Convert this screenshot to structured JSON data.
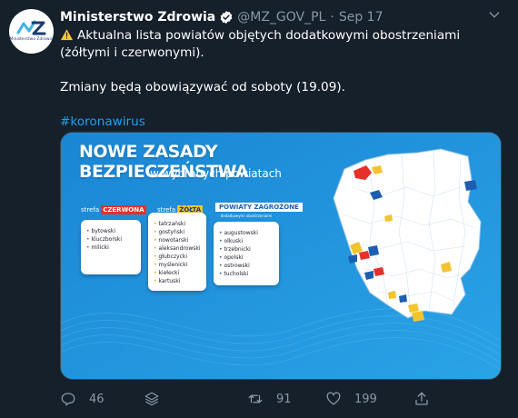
{
  "tweet": {
    "author_name": "Ministerstwo Zdrowia",
    "handle": "@MZ_GOV_PL",
    "separator": "·",
    "date": "Sep 17",
    "avatar_logo_text": "Ministerstwo Zdrowia",
    "text_line1": "Aktualna lista powiatów objętych dodatkowymi obostrzeniami (żółtymi i czerwonymi).",
    "text_line2": "Zmiany będą obowiązywać od soboty (19.09).",
    "hashtag": "#koronawirus"
  },
  "infographic": {
    "title": "NOWE ZASADY BEZPIECZEŃSTWA",
    "subtitle": "w wybranych powiatach",
    "red_zone": {
      "prefix": "strefa",
      "label": "CZERWONA",
      "items": [
        "bytowski",
        "kluczborski",
        "milicki"
      ]
    },
    "yellow_zone": {
      "prefix": "strefa",
      "label": "ŻÓŁTA",
      "items": [
        "tatrzański",
        "gostyński",
        "nowotarski",
        "aleksandrowski",
        "głubczycki",
        "myślenicki",
        "kiełecki",
        "kartuski"
      ]
    },
    "threatened": {
      "label": "POWIATY ZAGROŻONE",
      "sublabel": "dodatkowymi obostrzeniami",
      "items": [
        "augustowski",
        "olkuski",
        "trzebnicki",
        "opolski",
        "ostrowski",
        "tucholski"
      ]
    },
    "colors": {
      "red": "#e7302a",
      "yellow": "#f2c430",
      "blue": "#1c5fb0",
      "background": "#1c8fd8"
    }
  },
  "actions": {
    "reply_count": "46",
    "retweet_count": "91",
    "like_count": "199"
  },
  "icons": [
    "verified-badge-icon",
    "caret-down-icon",
    "warning-icon",
    "reply-icon",
    "stack-icon",
    "retweet-icon",
    "heart-icon",
    "share-icon"
  ]
}
